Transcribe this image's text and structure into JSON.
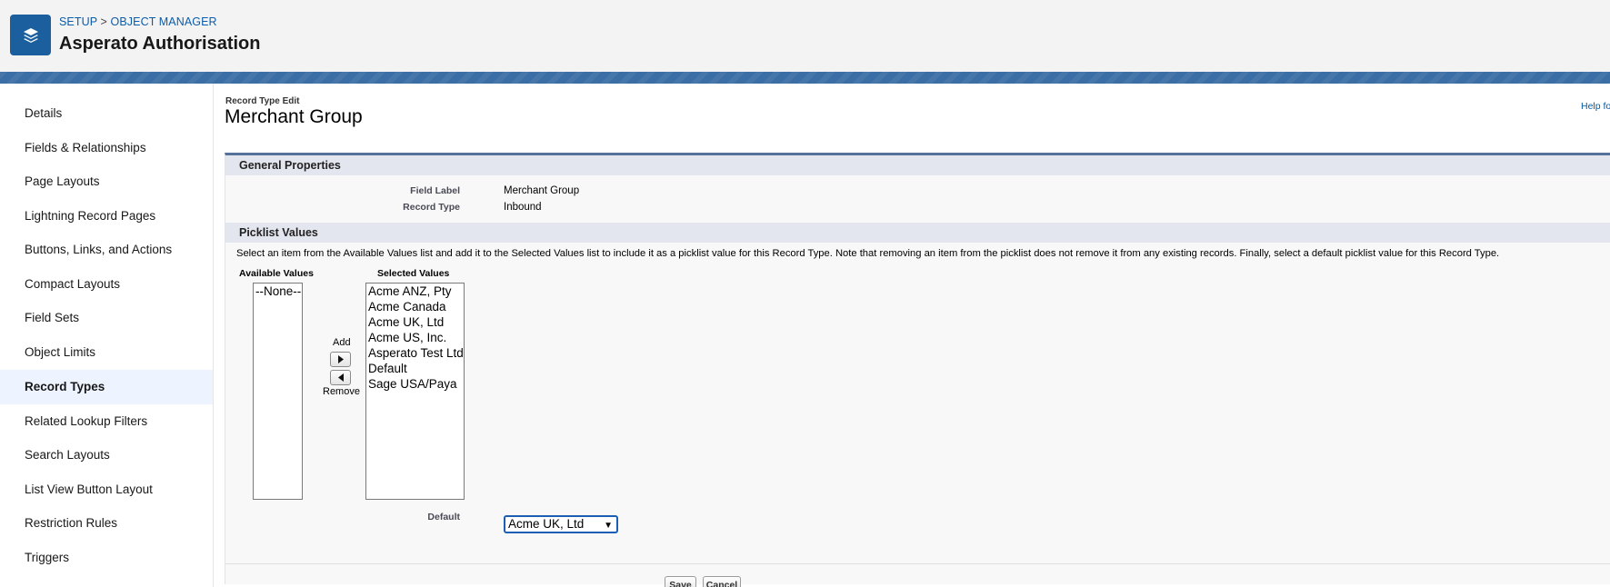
{
  "header": {
    "breadcrumb_setup": "SETUP",
    "breadcrumb_separator": ">",
    "breadcrumb_object_manager": "OBJECT MANAGER",
    "title": "Asperato Authorisation",
    "app_icon": "layers-icon"
  },
  "sidebar": {
    "items": [
      {
        "label": "Details"
      },
      {
        "label": "Fields & Relationships"
      },
      {
        "label": "Page Layouts"
      },
      {
        "label": "Lightning Record Pages"
      },
      {
        "label": "Buttons, Links, and Actions"
      },
      {
        "label": "Compact Layouts"
      },
      {
        "label": "Field Sets"
      },
      {
        "label": "Object Limits"
      },
      {
        "label": "Record Types"
      },
      {
        "label": "Related Lookup Filters"
      },
      {
        "label": "Search Layouts"
      },
      {
        "label": "List View Button Layout"
      },
      {
        "label": "Restriction Rules"
      },
      {
        "label": "Triggers"
      }
    ],
    "active_item": "Record Types"
  },
  "main": {
    "subtitle": "Record Type Edit",
    "title": "Merchant Group",
    "help_link": "Help fo",
    "general": {
      "heading": "General Properties",
      "field_label_label": "Field Label",
      "field_label_value": "Merchant Group",
      "record_type_label": "Record Type",
      "record_type_value": "Inbound"
    },
    "picklist": {
      "heading": "Picklist Values",
      "instructions": "Select an item from the Available Values list and add it to the Selected Values list to include it as a picklist value for this Record Type. Note that removing an item from the picklist does not remove it from any existing records. Finally, select a default picklist value for this Record Type.",
      "available_label": "Available Values",
      "selected_label": "Selected Values",
      "available_values": [
        "--None--"
      ],
      "selected_values": [
        "Acme ANZ, Pty",
        "Acme Canada",
        "Acme UK, Ltd",
        "Acme US, Inc.",
        "Asperato Test Ltd",
        "Default",
        "Sage USA/Paya"
      ],
      "add_label": "Add",
      "remove_label": "Remove",
      "default_label": "Default",
      "default_value": "Acme UK, Ltd"
    },
    "buttons": {
      "save": "Save",
      "cancel": "Cancel"
    }
  }
}
